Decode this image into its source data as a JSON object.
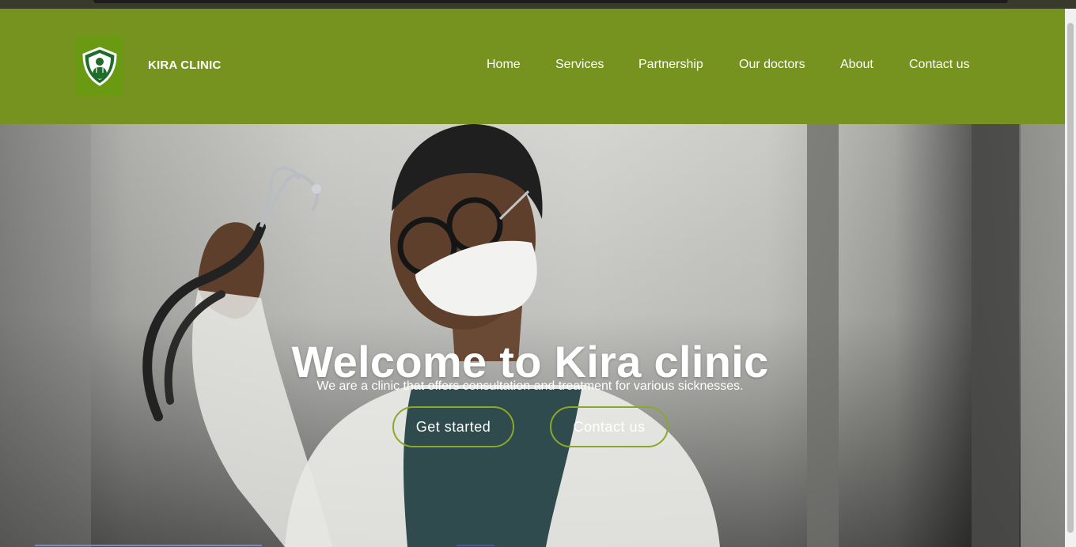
{
  "brand": {
    "name": "KIRA CLINIC"
  },
  "nav": {
    "items": [
      {
        "label": "Home"
      },
      {
        "label": "Services"
      },
      {
        "label": "Partnership"
      },
      {
        "label": "Our doctors"
      },
      {
        "label": "About"
      },
      {
        "label": "Contact us"
      }
    ]
  },
  "hero": {
    "title": "Welcome to Kira clinic",
    "subtitle": "We are a clinic that offers consultation and treatment for various sicknesses.",
    "primary_button": "Get started",
    "secondary_button": "Contact us"
  },
  "colors": {
    "nav_background": "#76921f",
    "logo_background": "#6a9a12",
    "button_border": "#8aa82a",
    "text": "#ffffff"
  },
  "icons": {
    "logo": "shield-doctor-icon"
  }
}
